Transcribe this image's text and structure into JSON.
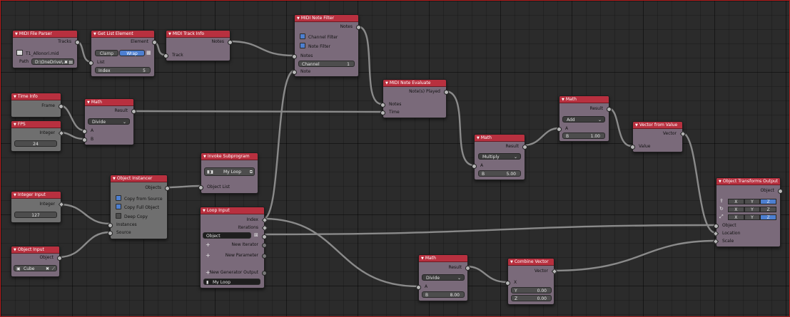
{
  "colors": {
    "header": "#b8303f",
    "body": "#7a6a7a",
    "link": "#8a8a8a",
    "accent": "#4d7fd0",
    "canvas": "#2b2b2b"
  },
  "nodes": {
    "midi_file_parser": {
      "title": "MIDI File Parser",
      "out_tracks": "Tracks",
      "file": "T1_Allonori.mid",
      "path_label": "Path",
      "path_value": "D:\\OneDrive\\..."
    },
    "get_list_element": {
      "title": "Get List Element",
      "out_element": "Element",
      "clamp": "Clamp",
      "wrap": "Wrap",
      "in_list": "List",
      "index_label": "Index",
      "index_value": "5"
    },
    "midi_track_info": {
      "title": "MIDI Track Info",
      "out_notes": "Notes",
      "in_track": "Track"
    },
    "midi_note_filter": {
      "title": "MIDI Note Filter",
      "out_notes": "Notes",
      "channel_filter": "Channel Filter",
      "note_filter": "Note Filter",
      "in_notes": "Notes",
      "channel_label": "Channel",
      "channel_value": "1",
      "in_note": "Note"
    },
    "midi_note_evaluate": {
      "title": "MIDI Note Evaluate",
      "out_played": "Note(s) Played",
      "in_notes": "Notes",
      "in_time": "Time"
    },
    "time_info": {
      "title": "Time Info",
      "out_frame": "Frame"
    },
    "fps": {
      "title": "FPS",
      "out_integer": "Integer",
      "value": "24"
    },
    "math_divide_top": {
      "title": "Math",
      "out_result": "Result",
      "op": "Divide",
      "in_a": "A",
      "in_b": "B"
    },
    "math_multiply": {
      "title": "Math",
      "out_result": "Result",
      "op": "Multiply",
      "in_a": "A",
      "b_label": "B",
      "b_value": "5.00"
    },
    "math_add": {
      "title": "Math",
      "out_result": "Result",
      "op": "Add",
      "in_a": "A",
      "b_label": "B",
      "b_value": "1.00"
    },
    "vector_from_value": {
      "title": "Vector from Value",
      "out_vector": "Vector",
      "in_value": "Value"
    },
    "object_transforms_output": {
      "title": "Object Transforms Output",
      "out_object": "Object",
      "axes": [
        "X",
        "Y",
        "Z"
      ],
      "in_object": "Object",
      "in_location": "Location",
      "in_scale": "Scale"
    },
    "invoke_subprogram": {
      "title": "Invoke Subprogram",
      "program": "My Loop",
      "in_object_list": "Object List"
    },
    "object_instancer": {
      "title": "Object Instancer",
      "out_objects": "Objects",
      "copy_from_source": "Copy from Source",
      "copy_full_object": "Copy Full Object",
      "deep_copy": "Deep Copy",
      "in_instances": "Instances",
      "in_source": "Source"
    },
    "integer_input": {
      "title": "Integer Input",
      "out_integer": "Integer",
      "value": "127"
    },
    "object_input": {
      "title": "Object Input",
      "out_object": "Object",
      "value": "Cube"
    },
    "loop_input": {
      "title": "Loop Input",
      "out_index": "Index",
      "out_iterations": "Iterations",
      "object_param": "Object",
      "new_iterator": "New Iterator",
      "new_parameter": "New Parameter",
      "new_generator_output": "New Generator Output",
      "loop_name": "My Loop"
    },
    "math_divide_bottom": {
      "title": "Math",
      "out_result": "Result",
      "op": "Divide",
      "in_a": "A",
      "b_label": "B",
      "b_value": "8.00"
    },
    "combine_vector": {
      "title": "Combine Vector",
      "out_vector": "Vector",
      "in_x": "X",
      "y_label": "Y",
      "y_value": "0.00",
      "z_label": "Z",
      "z_value": "0.00"
    }
  }
}
